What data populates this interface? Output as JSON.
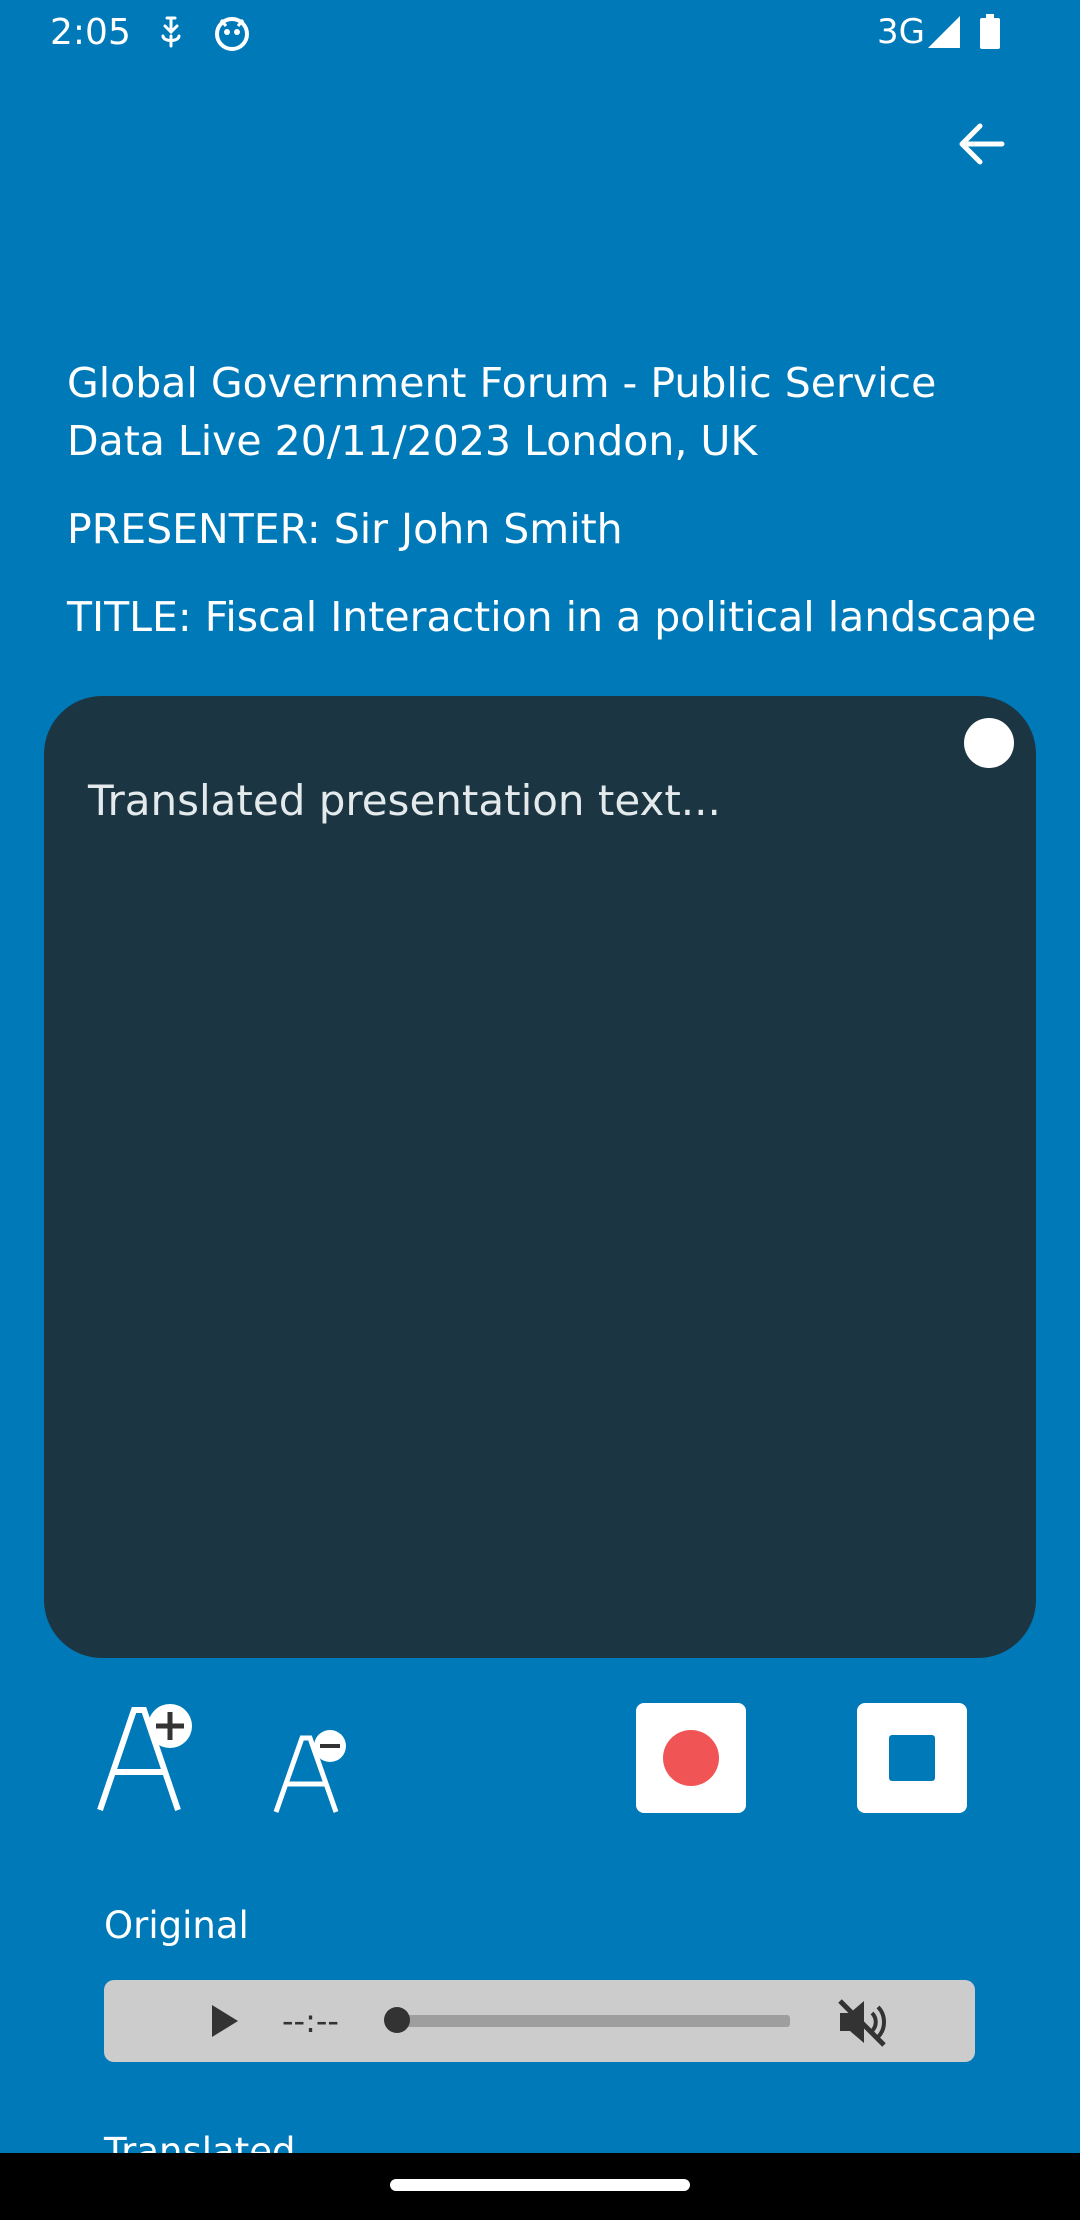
{
  "status_bar": {
    "time": "2:05",
    "network": "3G",
    "icons": [
      "download-notification-icon",
      "app-notification-icon",
      "signal-icon",
      "battery-icon"
    ]
  },
  "header": {
    "back_icon": "arrow-left-icon"
  },
  "event": {
    "name": "Global Government Forum - Public Service Data Live 20/11/2023 London, UK",
    "presenter": "PRESENTER: Sir John Smith",
    "title": "TITLE: Fiscal Interaction in a political landscape"
  },
  "translation_panel": {
    "text": "Translated presentation text..."
  },
  "controls": {
    "increase_font_icon": "font-increase-icon",
    "decrease_font_icon": "font-decrease-icon",
    "record_icon": "record-icon",
    "stop_icon": "stop-icon"
  },
  "audio": {
    "original_label": "Original",
    "translated_label": "Translated",
    "player": {
      "time": "--:--",
      "progress": 0,
      "muted": true
    }
  },
  "colors": {
    "background": "#0079b8",
    "panel": "#1b3642",
    "record": "#f05454",
    "player": "#cccccc"
  }
}
